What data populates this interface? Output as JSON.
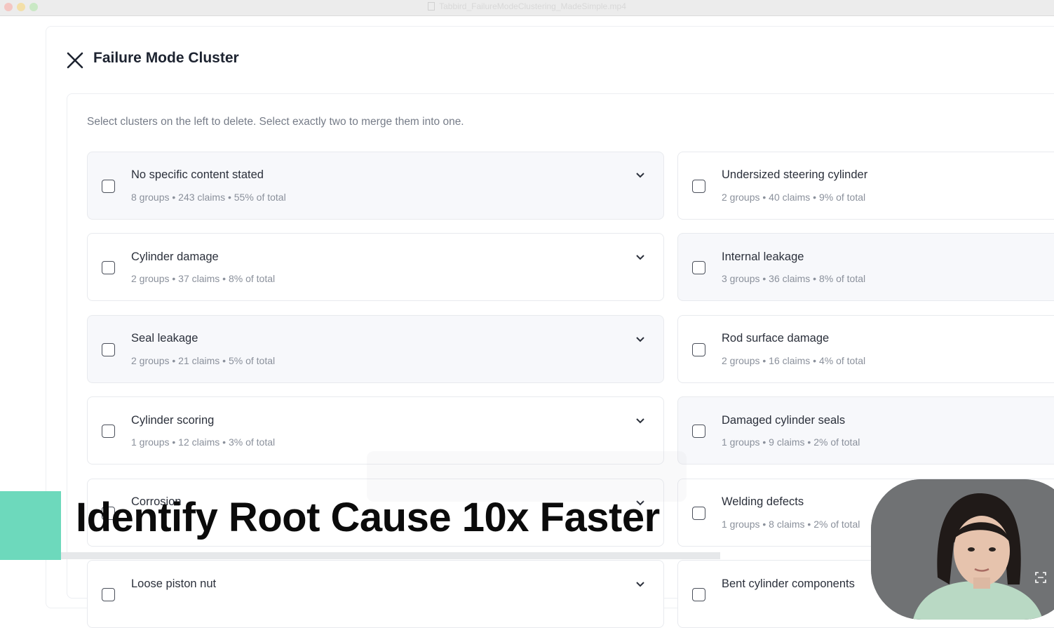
{
  "window": {
    "title": "Tabbird_FailureModeClustering_MadeSimple.mp4"
  },
  "header": {
    "title": "Failure Mode Cluster"
  },
  "instructions": "Select clusters on the left to delete. Select exactly two to merge them into one.",
  "clusters_left": [
    {
      "title": "No specific content stated",
      "meta": "8 groups • 243 claims • 55% of total"
    },
    {
      "title": "Cylinder damage",
      "meta": "2 groups • 37 claims • 8% of total"
    },
    {
      "title": "Seal leakage",
      "meta": "2 groups • 21 claims • 5% of total"
    },
    {
      "title": "Cylinder scoring",
      "meta": "1 groups • 12 claims • 3% of total"
    },
    {
      "title": "Corrosion",
      "meta": ""
    },
    {
      "title": "Loose piston nut",
      "meta": ""
    }
  ],
  "clusters_right": [
    {
      "title": "Undersized steering cylinder",
      "meta": "2 groups • 40 claims • 9% of total"
    },
    {
      "title": "Internal leakage",
      "meta": "3 groups • 36 claims • 8% of total"
    },
    {
      "title": "Rod surface damage",
      "meta": "2 groups • 16 claims • 4% of total"
    },
    {
      "title": "Damaged cylinder seals",
      "meta": "1 groups • 9 claims • 2% of total"
    },
    {
      "title": "Welding defects",
      "meta": "1 groups • 8 claims • 2% of total"
    },
    {
      "title": "Bent cylinder components",
      "meta": ""
    }
  ],
  "overlay": {
    "headline": "Identify Root Cause 10x Faster"
  },
  "colors": {
    "brand_accent": "#6dd9bc",
    "card_shaded": "#f7f8fb"
  }
}
